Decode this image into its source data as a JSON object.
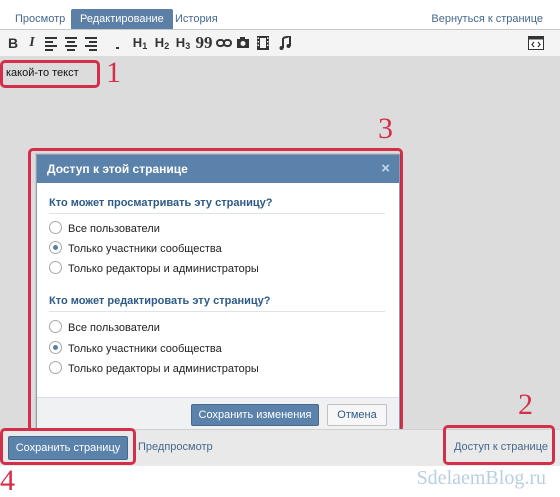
{
  "tabs": {
    "view": "Просмотр",
    "edit": "Редактирование",
    "history": "История",
    "back": "Вернуться к странице"
  },
  "toolbar": {
    "bold": "B",
    "italic": "I",
    "h1": "H",
    "h2": "H",
    "h3": "H",
    "h1_sub": "1",
    "h2_sub": "2",
    "h3_sub": "3",
    "quote": "99",
    "icons": [
      "align-left-icon",
      "align-center-icon",
      "align-right-icon",
      "list-icon",
      "link-icon",
      "photo-icon",
      "video-icon",
      "audio-icon",
      "source-icon"
    ]
  },
  "editor": {
    "text": "какой-то текст"
  },
  "dialog": {
    "title": "Доступ к этой странице",
    "close": "×",
    "view_question": "Кто может просматривать эту страницу?",
    "edit_question": "Кто может редактировать эту страницу?",
    "options": [
      "Все пользователи",
      "Только участники сообщества",
      "Только редакторы и администраторы"
    ],
    "view_selected": 1,
    "edit_selected": 1,
    "save": "Сохранить изменения",
    "cancel": "Отмена"
  },
  "bottom": {
    "save_page": "Сохранить страницу",
    "preview": "Предпросмотр",
    "access": "Доступ к странице"
  },
  "annotations": [
    "1",
    "2",
    "3",
    "4"
  ],
  "watermark": "SdelaemBlog.ru",
  "colors": {
    "accent": "#5b82aa",
    "link": "#45688e",
    "annotation": "#d32f4a"
  }
}
